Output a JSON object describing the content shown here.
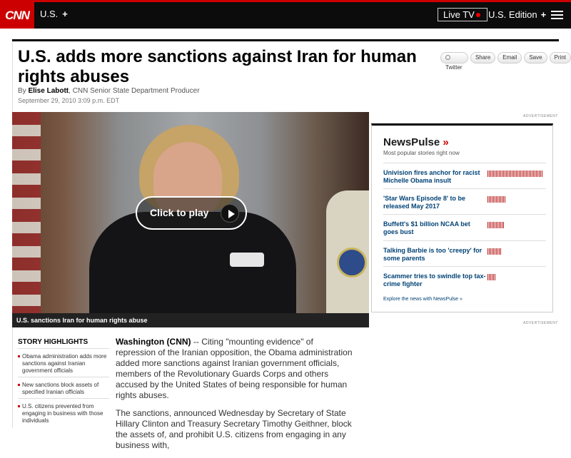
{
  "header": {
    "logo": "CNN",
    "section": "U.S.",
    "section_plus": "+",
    "live_tv": "Live TV",
    "edition": "U.S. Edition",
    "edition_plus": "+"
  },
  "article": {
    "headline": "U.S. adds more sanctions against Iran for human rights abuses",
    "by": "By",
    "author": "Elise Labott",
    "author_title": ", CNN Senior State Department Producer",
    "date": "September 29, 2010 3:09 p.m. EDT"
  },
  "share": {
    "twitter": "Twitter",
    "share": "Share",
    "email": "Email",
    "save": "Save",
    "print": "Print"
  },
  "video": {
    "play_label": "Click to play",
    "caption": "U.S. sanctions Iran for human rights abuse"
  },
  "ads": {
    "label_top": "ADVERTISEMENT",
    "label_bottom": "ADVERTISEMENT"
  },
  "newspulse": {
    "title": "NewsPulse",
    "chevron": "»",
    "subtitle": "Most popular stories right now",
    "items": [
      {
        "title": "Univision fires anchor for racist Michelle Obama insult",
        "popularity": 1.0
      },
      {
        "title": "'Star Wars Episode 8' to be released May 2017",
        "popularity": 0.32
      },
      {
        "title": "Buffett's $1 billion NCAA bet goes bust",
        "popularity": 0.29
      },
      {
        "title": "Talking Barbie is too 'creepy' for some parents",
        "popularity": 0.24
      },
      {
        "title": "Scammer tries to swindle top tax-crime fighter",
        "popularity": 0.15
      }
    ],
    "explore": "Explore the news with NewsPulse »"
  },
  "highlights": {
    "title": "STORY HIGHLIGHTS",
    "items": [
      "Obama administration adds more sanctions against Iranian government officials",
      "New sanctions block assets of specified Iranian officials",
      "U.S. citizens prevented from engaging in business with those individuals"
    ]
  },
  "body": {
    "dateline": "Washington (CNN)",
    "p1": " -- Citing \"mounting evidence\" of repression of the Iranian opposition, the Obama administration added more sanctions against Iranian government officials, members of the Revolutionary Guards Corps and others accused by the United States of being responsible for human rights abuses.",
    "p2": "The sanctions, announced Wednesday by Secretary of State Hillary Clinton and Treasury Secretary Timothy Geithner, block the assets of, and prohibit U.S. citizens from engaging in any business with,"
  },
  "colors": {
    "brand_red": "#cc0000",
    "link_blue": "#004276",
    "topbar": "#0c0c0c"
  }
}
